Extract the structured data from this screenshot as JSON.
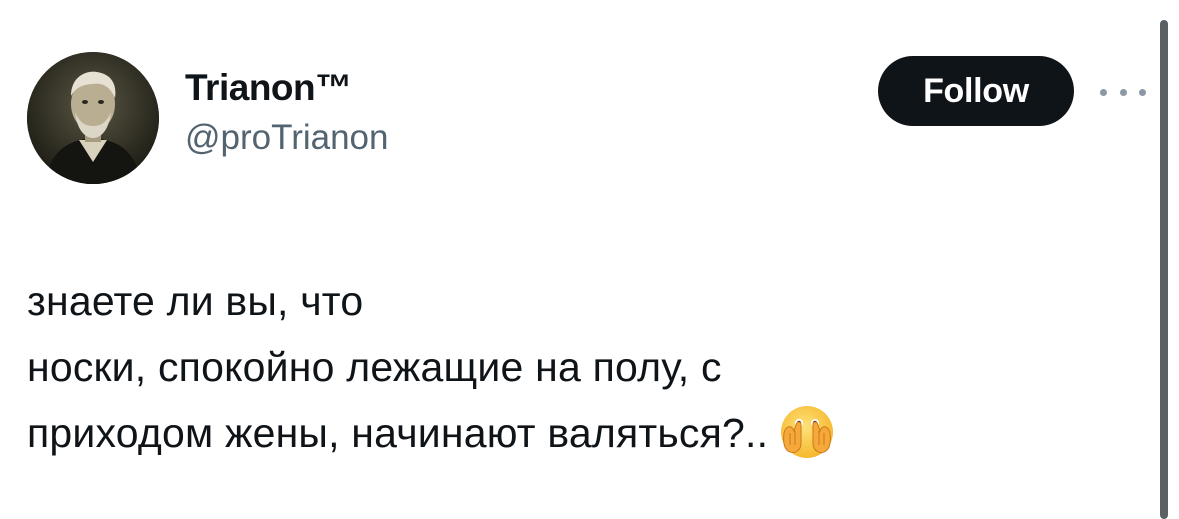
{
  "author": {
    "display_name": "Trianon™",
    "handle": "@proTrianon"
  },
  "actions": {
    "follow_label": "Follow",
    "more_icon": "more-horizontal-icon"
  },
  "tweet": {
    "lines": [
      "знаете ли вы, что",
      "носки, спокойно лежащие на полу, с",
      "приходом жены, начинают валяться?.."
    ],
    "emoji": "face-with-open-eyes-and-hand-over-mouth"
  },
  "colors": {
    "text": "#0f1419",
    "secondary_text": "#536471",
    "follow_bg": "#0f1419",
    "follow_text": "#ffffff"
  }
}
